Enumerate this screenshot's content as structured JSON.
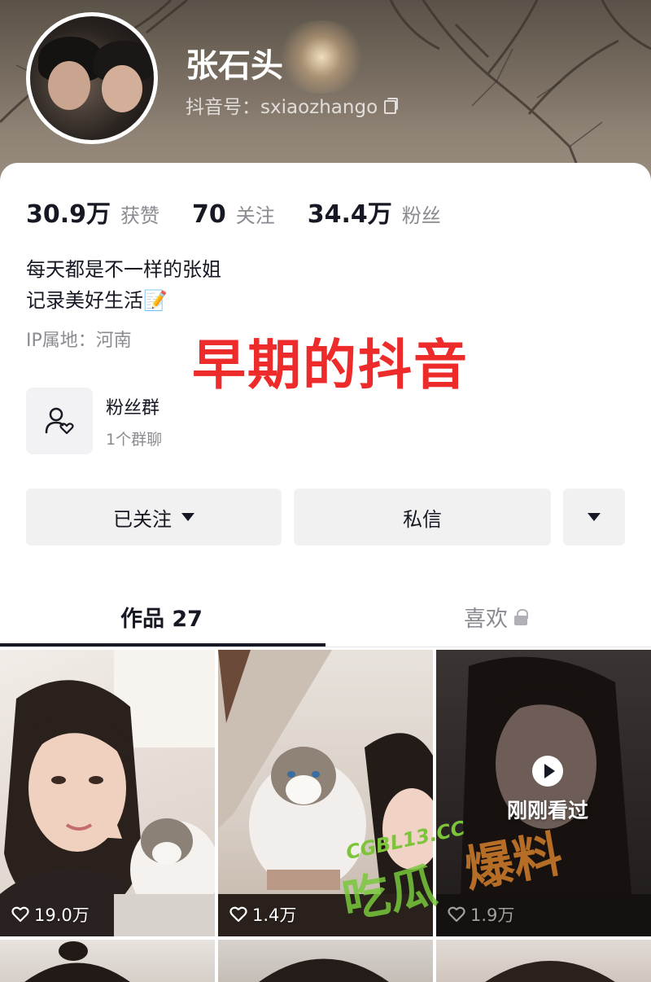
{
  "profile": {
    "name": "张石头",
    "douyin_id": "抖音号：sxiaozhango"
  },
  "stats": [
    {
      "value": "30.9万",
      "label": "获赞"
    },
    {
      "value": "70",
      "label": "关注"
    },
    {
      "value": "34.4万",
      "label": "粉丝"
    }
  ],
  "bio": {
    "line1": "每天都是不一样的张姐",
    "line2": "记录美好生活📝",
    "ip": "IP属地：河南"
  },
  "overlay_caption": "早期的抖音",
  "fans_group": {
    "title": "粉丝群",
    "subtitle": "1个群聊"
  },
  "actions": {
    "follow_label": "已关注",
    "message_label": "私信"
  },
  "tabs": {
    "works_label": "作品 27",
    "likes_label": "喜欢"
  },
  "videos": [
    {
      "likes": "19.0万"
    },
    {
      "likes": "1.4万"
    },
    {
      "likes": "1.9万",
      "watched_label": "刚刚看过"
    }
  ],
  "watermark": {
    "small": "CGBL13.CC",
    "big_left": "吃瓜",
    "big_right": "爆料"
  },
  "colors": {
    "accent_red": "#ee2b2b",
    "text_primary": "#161823",
    "text_secondary": "#8a8b91",
    "button_bg": "#f1f1f2"
  }
}
